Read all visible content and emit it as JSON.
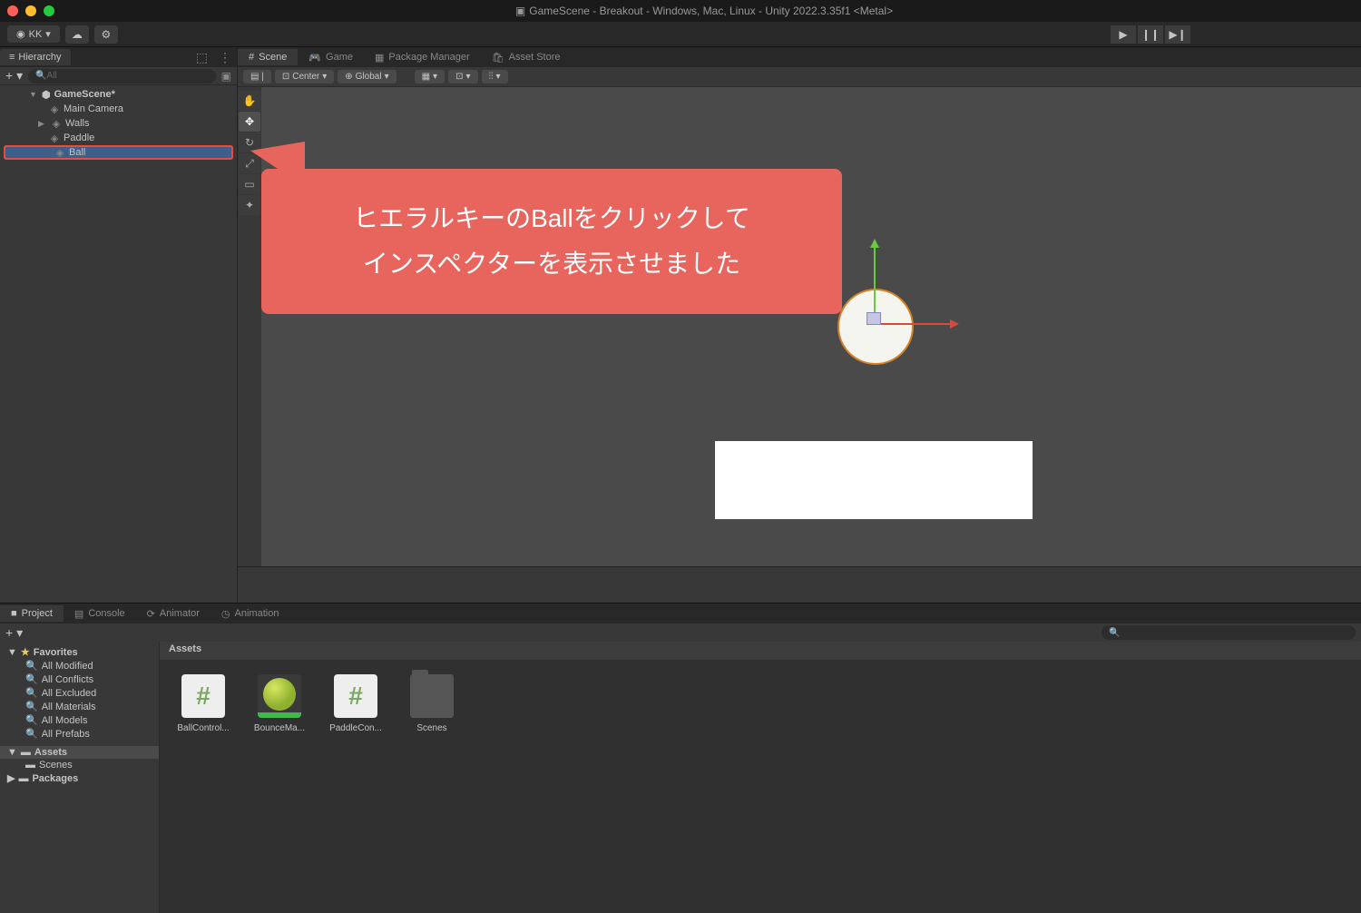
{
  "window": {
    "title": "GameScene - Breakout - Windows, Mac, Linux - Unity 2022.3.35f1 <Metal>"
  },
  "toolbar": {
    "account": "KK",
    "account_dropdown": "▾"
  },
  "hierarchy": {
    "tab_label": "Hierarchy",
    "search_placeholder": "All",
    "scene_name": "GameScene*",
    "items": [
      {
        "label": "Main Camera"
      },
      {
        "label": "Walls"
      },
      {
        "label": "Paddle"
      },
      {
        "label": "Ball"
      }
    ]
  },
  "scene_tabs": {
    "scene": "Scene",
    "game": "Game",
    "package_manager": "Package Manager",
    "asset_store": "Asset Store"
  },
  "scene_toolbar": {
    "pivot": "Center",
    "space": "Global"
  },
  "callout": {
    "line1": "ヒエラルキーのBallをクリックして",
    "line2": "インスペクターを表示させました"
  },
  "project": {
    "tabs": {
      "project": "Project",
      "console": "Console",
      "animator": "Animator",
      "animation": "Animation"
    },
    "favorites_label": "Favorites",
    "favorites": [
      "All Modified",
      "All Conflicts",
      "All Excluded",
      "All Materials",
      "All Models",
      "All Prefabs"
    ],
    "assets_label": "Assets",
    "assets_children": [
      "Scenes"
    ],
    "packages_label": "Packages",
    "breadcrumb": "Assets",
    "assets": [
      {
        "label": "BallControl...",
        "type": "script"
      },
      {
        "label": "BounceMa...",
        "type": "material"
      },
      {
        "label": "PaddleCon...",
        "type": "script"
      },
      {
        "label": "Scenes",
        "type": "folder"
      }
    ]
  }
}
